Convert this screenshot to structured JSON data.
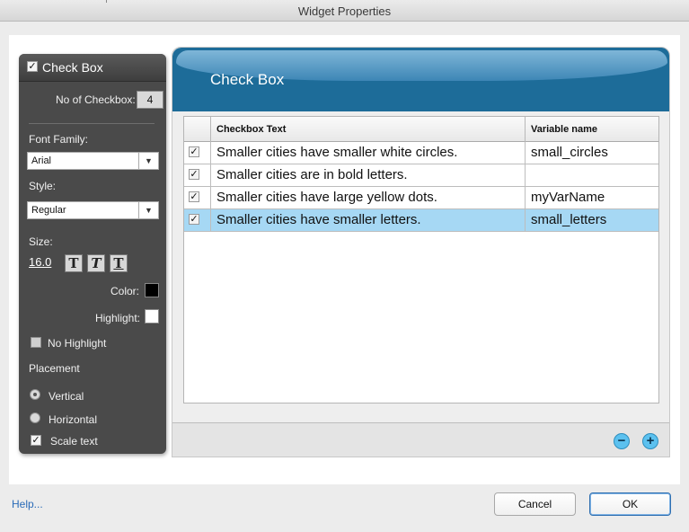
{
  "window": {
    "title": "Widget Properties"
  },
  "panel": {
    "title": "Check Box",
    "title_checked": true,
    "count_label": "No of Checkbox:",
    "count_value": "4",
    "font_family_label": "Font Family:",
    "font_family_value": "Arial",
    "style_label": "Style:",
    "style_value": "Regular",
    "size_label": "Size:",
    "size_value": "16.0",
    "format_buttons": {
      "bold": "T",
      "italic": "T",
      "underline": "T"
    },
    "color_label": "Color:",
    "color_value": "#000000",
    "highlight_label": "Highlight:",
    "highlight_value": "#ffffff",
    "no_highlight_label": "No Highlight",
    "no_highlight_checked": false,
    "placement_label": "Placement",
    "vertical_label": "Vertical",
    "horizontal_label": "Horizontal",
    "placement_selected": "Vertical",
    "scale_text_label": "Scale text",
    "scale_text_checked": true
  },
  "editor": {
    "title": "Check Box",
    "columns": [
      "Checkbox Text",
      "Variable name"
    ],
    "rows": [
      {
        "checked": true,
        "text": "Smaller cities have smaller white circles.",
        "var": "small_circles",
        "selected": false
      },
      {
        "checked": true,
        "text": "Smaller cities are in bold letters.",
        "var": "",
        "selected": false
      },
      {
        "checked": true,
        "text": "Smaller cities have large yellow dots.",
        "var": "myVarName",
        "selected": false
      },
      {
        "checked": true,
        "text": "Smaller cities have smaller letters.",
        "var": "small_letters",
        "selected": true
      }
    ],
    "remove_symbol": "−",
    "add_symbol": "+"
  },
  "footer": {
    "help": "Help...",
    "cancel": "Cancel",
    "ok": "OK"
  },
  "colors": {
    "accent": "#1d6c99",
    "selection": "#a6d8f4",
    "panel": "#4a4a4a"
  }
}
